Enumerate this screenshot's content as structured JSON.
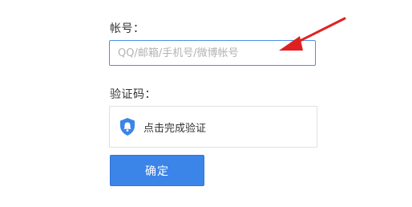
{
  "form": {
    "account_label": "帐号：",
    "account_placeholder": "QQ/邮箱/手机号/微博帐号",
    "account_value": "",
    "captcha_label": "验证码：",
    "captcha_text": "点击完成验证",
    "submit_label": "确定"
  },
  "icons": {
    "captcha_icon": "shield-bell-icon",
    "annotation": "red-arrow-icon"
  },
  "colors": {
    "accent": "#3b84e8",
    "input_border": "#4a90e2",
    "arrow": "#e02020"
  }
}
